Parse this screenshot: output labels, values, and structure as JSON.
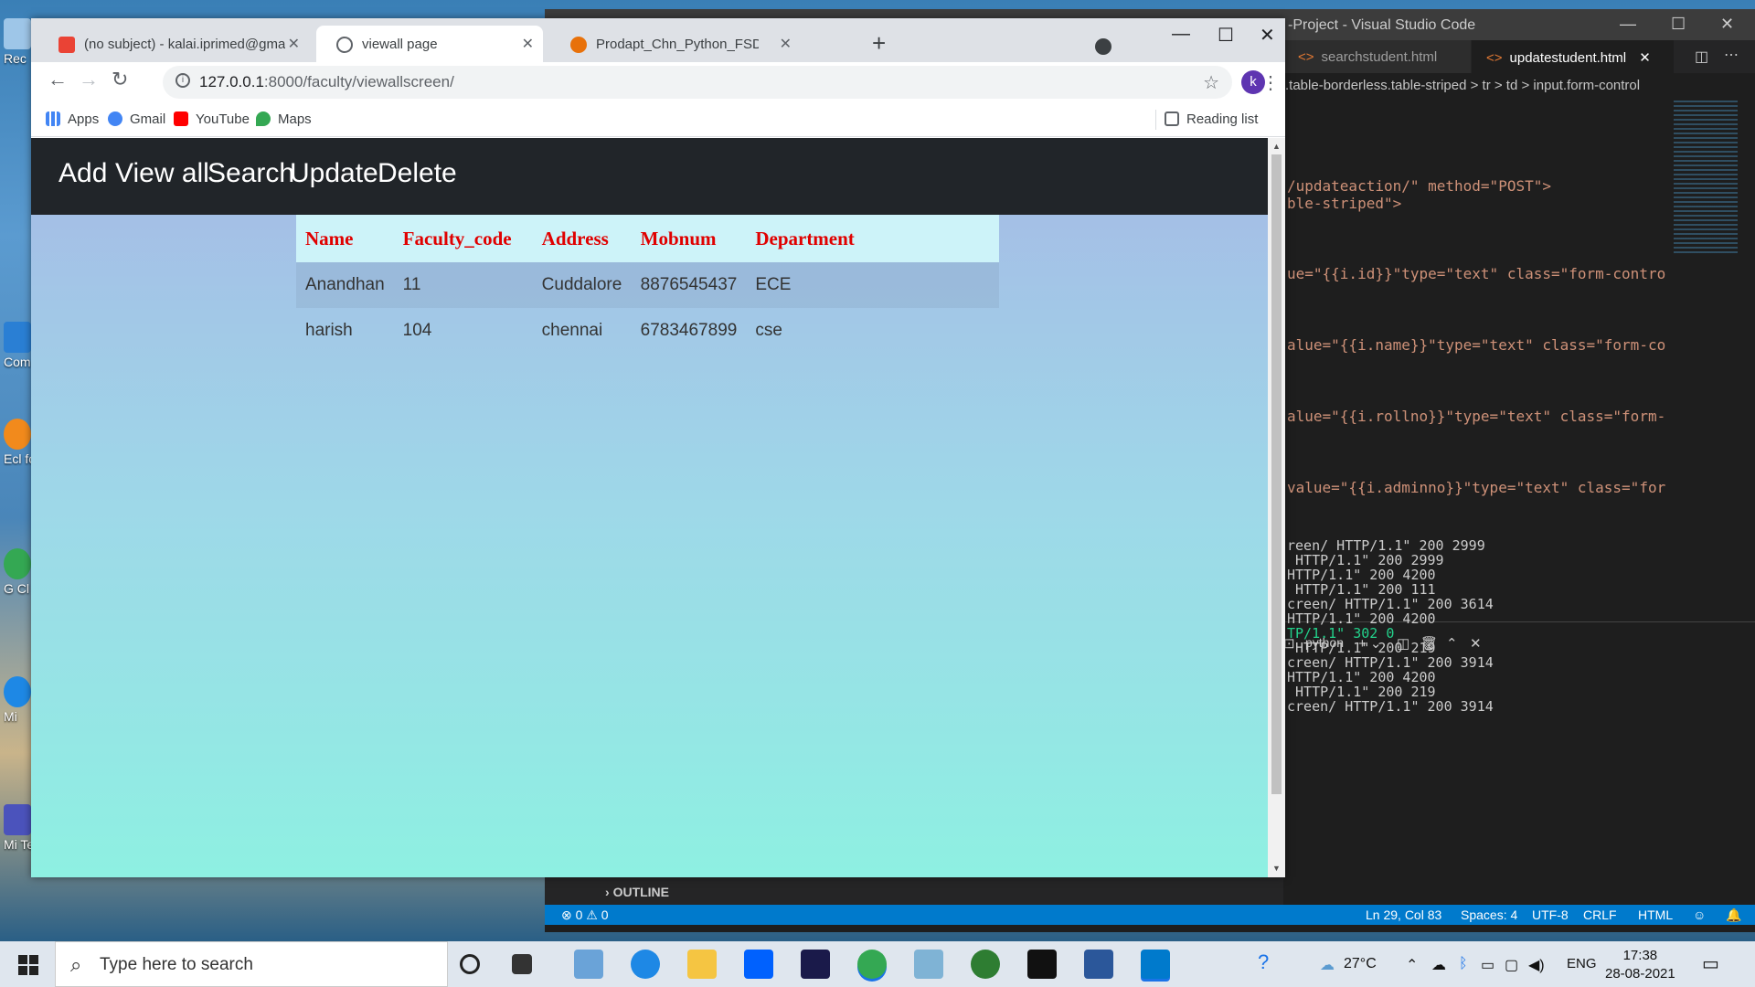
{
  "desktop": {
    "icons": [
      {
        "label": "Rec"
      },
      {
        "label": "Com"
      },
      {
        "label": "Ecl for"
      },
      {
        "label": "G Cl"
      },
      {
        "label": "Mi"
      },
      {
        "label": "Mi Teams"
      }
    ]
  },
  "vscode": {
    "title": "-Project - Visual Studio Code",
    "tabs": [
      "searchstudent.html",
      "updatestudent.html"
    ],
    "breadcrumb": ".table-borderless.table-striped  >  tr  >  td  >  input.form-control",
    "code_lines": [
      "/updateaction/\" method=\"POST\">",
      "ble-striped\">",
      "ue=\"{{i.id}}\"type=\"text\" class=\"form-contro",
      "alue=\"{{i.name}}\"type=\"text\" class=\"form-co",
      "alue=\"{{i.rollno}}\"type=\"text\" class=\"form-",
      "value=\"{{i.adminno}}\"type=\"text\" class=\"for"
    ],
    "terminal_label": "python",
    "terminal_lines": [
      "reen/ HTTP/1.1\" 200 2999",
      " HTTP/1.1\" 200 2999",
      "HTTP/1.1\" 200 4200",
      " HTTP/1.1\" 200 111",
      "creen/ HTTP/1.1\" 200 3614",
      "HTTP/1.1\" 200 4200",
      "TP/1.1\" 302 0",
      " HTTP/1.1\" 200 219",
      "creen/ HTTP/1.1\" 200 3914",
      "HTTP/1.1\" 200 4200",
      " HTTP/1.1\" 200 219",
      "creen/ HTTP/1.1\" 200 3914"
    ],
    "outline_label": "OUTLINE",
    "status": {
      "problems": "⊗ 0 ⚠ 0",
      "position": "Ln 29, Col 83",
      "spaces": "Spaces: 4",
      "encoding": "UTF-8",
      "eol": "CRLF",
      "language": "HTML"
    }
  },
  "chrome": {
    "tabs": [
      {
        "title": "(no subject) - kalai.iprimed@gma",
        "favicon_color": "#ea4335"
      },
      {
        "title": "viewall page",
        "favicon_color": "#5f6368"
      },
      {
        "title": "Prodapt_Chn_Python_FSD_14: Co",
        "favicon_color": "#e8710a"
      }
    ],
    "url_host": "127.0.0.1",
    "url_path": ":8000/faculty/viewallscreen/",
    "profile_initial": "k",
    "bookmarks": [
      "Apps",
      "Gmail",
      "YouTube",
      "Maps"
    ],
    "reading_list": "Reading list"
  },
  "page": {
    "nav": [
      "Add",
      "View all",
      "Search",
      "Update",
      "Delete"
    ],
    "table": {
      "headers": [
        "Name",
        "Faculty_code",
        "Address",
        "Mobnum",
        "Department"
      ],
      "rows": [
        [
          "Anandhan",
          "11",
          "Cuddalore",
          "8876545437",
          "ECE"
        ],
        [
          "harish",
          "104",
          "chennai",
          "6783467899",
          "cse"
        ]
      ]
    }
  },
  "taskbar": {
    "search_placeholder": "Type here to search",
    "weather": "27°C",
    "language": "ENG",
    "time": "17:38",
    "date": "28-08-2021"
  }
}
